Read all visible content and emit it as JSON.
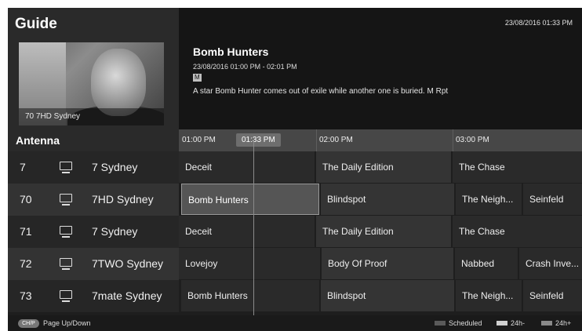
{
  "app": {
    "title": "Guide",
    "clock": "23/08/2016 01:33 PM"
  },
  "preview": {
    "caption": "70 7HD Sydney"
  },
  "details": {
    "title": "Bomb Hunters",
    "time": "23/08/2016 01:00 PM - 02:01 PM",
    "rating": "M",
    "description": "A star Bomb Hunter comes out of exile while another one is buried. M Rpt"
  },
  "header": {
    "source": "Antenna",
    "times": [
      "01:00 PM",
      "02:00 PM",
      "03:00 PM"
    ],
    "now": "01:33 PM",
    "arrow": "›"
  },
  "channels": [
    {
      "num": "7",
      "name": "7 Sydney"
    },
    {
      "num": "70",
      "name": "7HD Sydney"
    },
    {
      "num": "71",
      "name": "7 Sydney"
    },
    {
      "num": "72",
      "name": "7TWO Sydney"
    },
    {
      "num": "73",
      "name": "7mate Sydney"
    }
  ],
  "programs": [
    [
      "Deceit",
      "The Daily Edition",
      "The Chase"
    ],
    [
      "Bomb Hunters",
      "Blindspot",
      "The Neigh...",
      "Seinfeld"
    ],
    [
      "Deceit",
      "The Daily Edition",
      "The Chase"
    ],
    [
      "Lovejoy",
      "Body Of Proof",
      "Nabbed",
      "Crash Inve..."
    ],
    [
      "Bomb Hunters",
      "Blindspot",
      "The Neigh...",
      "Seinfeld"
    ]
  ],
  "footer": {
    "chp_icon": "CH/P",
    "page_label": "Page Up/Down",
    "legend": [
      {
        "label": "Scheduled",
        "color": "#5a5a5a"
      },
      {
        "label": "24h-",
        "color": "#d0d0d0"
      },
      {
        "label": "24h+",
        "color": "#8a8a8a"
      }
    ]
  }
}
